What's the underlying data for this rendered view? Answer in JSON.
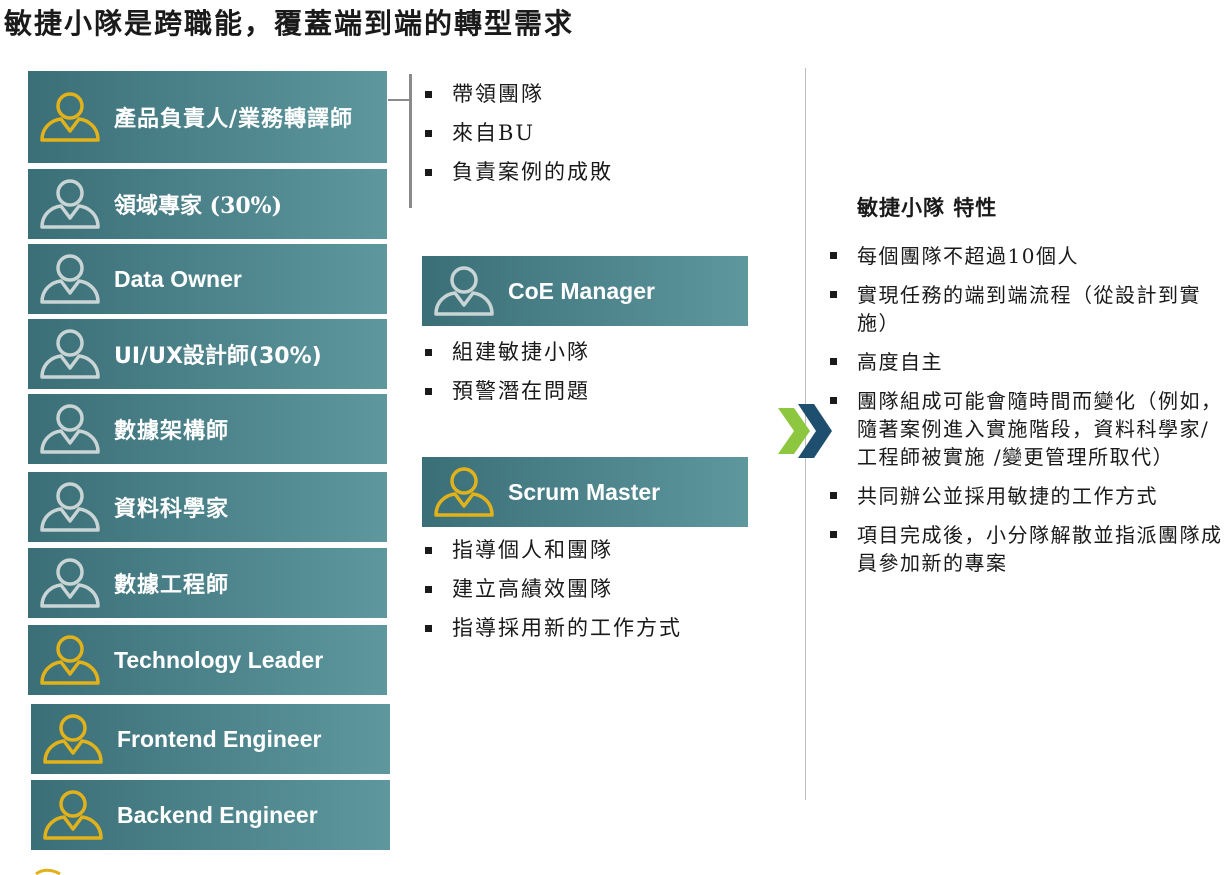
{
  "title": "敏捷小隊是跨職能，覆蓋端到端的轉型需求",
  "colors": {
    "panel_start": "#3b6f78",
    "panel_end": "#5e979e",
    "icon_gold": "#e2b21a",
    "icon_gray": "#c9d4d5",
    "chevron_green": "#8dc63f",
    "chevron_navy": "#1e4f6e"
  },
  "roles": [
    {
      "label": "產品負責人/業務轉譯師",
      "icon": "person-gold-icon"
    },
    {
      "label": "領域專家 (30%)",
      "icon": "person-gray-icon"
    },
    {
      "label": "Data Owner",
      "icon": "person-gray-icon"
    },
    {
      "label": "UI/UX設計師(30%)",
      "icon": "person-gray-icon"
    },
    {
      "label": "數據架構師",
      "icon": "person-gray-icon"
    },
    {
      "label": "資料科學家",
      "icon": "person-gray-icon"
    },
    {
      "label": "數據工程師",
      "icon": "person-gray-icon"
    },
    {
      "label": "Technology Leader",
      "icon": "person-gold-icon"
    },
    {
      "label": "Frontend Engineer",
      "icon": "person-gold-icon"
    },
    {
      "label": "Backend Engineer",
      "icon": "person-gold-icon"
    }
  ],
  "po_bullets": [
    "帶領團隊",
    "來自BU",
    "負責案例的成敗"
  ],
  "coe": {
    "label": "CoE Manager",
    "icon": "person-gray-icon",
    "bullets": [
      "組建敏捷小隊",
      "預警潛在問題"
    ]
  },
  "scrum": {
    "label": "Scrum Master",
    "icon": "person-gold-icon",
    "bullets": [
      "指導個人和團隊",
      "建立高績效團隊",
      "指導採用新的工作方式"
    ]
  },
  "traits": {
    "heading": "敏捷小隊 特性",
    "items": [
      "每個團隊不超過10個人",
      "實現任務的端到端流程（從設計到實施）",
      "高度自主",
      "團隊組成可能會隨時間而變化（例如，隨著案例進入實施階段，資料科學家/工程師被實施 /變更管理所取代）",
      "共同辦公並採用敏捷的工作方式",
      "項目完成後，小分隊解散並指派團隊成員參加新的專案"
    ]
  }
}
